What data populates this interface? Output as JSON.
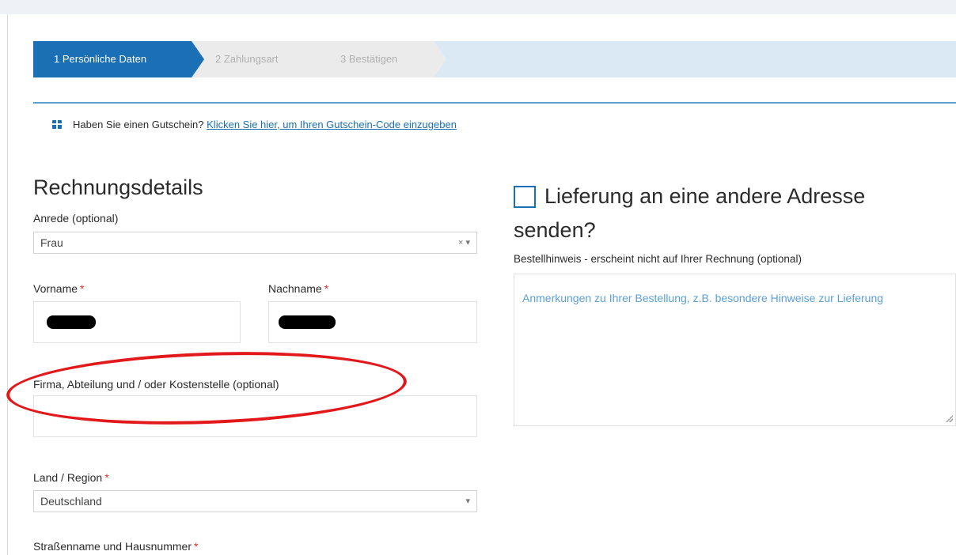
{
  "steps": [
    {
      "label": "1 Persönliche Daten"
    },
    {
      "label": "2 Zahlungsart"
    },
    {
      "label": "3 Bestätigen"
    }
  ],
  "coupon": {
    "icon": "gift-icon",
    "text": "Haben Sie einen Gutschein?",
    "link": "Klicken Sie hier, um Ihren Gutschein-Code einzugeben"
  },
  "billing": {
    "title": "Rechnungsdetails",
    "salutation": {
      "label": "Anrede (optional)",
      "value": "Frau",
      "clear": "×",
      "arrow": "▾"
    },
    "firstname": {
      "label": "Vorname",
      "required": "*"
    },
    "lastname": {
      "label": "Nachname",
      "required": "*"
    },
    "company": {
      "label": "Firma, Abteilung und / oder Kostenstelle (optional)"
    },
    "country": {
      "label": "Land / Region",
      "required": "*",
      "value": "Deutschland",
      "arrow": "▾"
    },
    "street": {
      "label": "Straßenname und Hausnummer",
      "required": "*"
    }
  },
  "shipping": {
    "title_line1": "Lieferung an eine andere Adresse",
    "title_line2": "senden?",
    "notes_label": "Bestellhinweis - erscheint nicht auf Ihrer Rechnung (optional)",
    "notes_placeholder": "Anmerkungen zu Ihrer Bestellung, z.B. besondere Hinweise zur Lieferung"
  },
  "colors": {
    "accent": "#1b6fb5",
    "required": "#e02b2b",
    "annotation": "#e2181b"
  }
}
